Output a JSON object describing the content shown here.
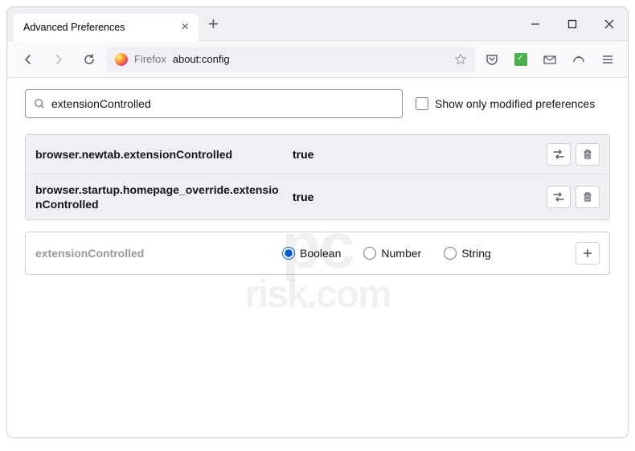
{
  "window": {
    "tab_title": "Advanced Preferences",
    "url_host": "Firefox",
    "url_path": "about:config"
  },
  "search": {
    "value": "extensionControlled",
    "checkbox_label": "Show only modified preferences"
  },
  "prefs": [
    {
      "name": "browser.newtab.extensionControlled",
      "value": "true"
    },
    {
      "name": "browser.startup.homepage_override.extensionControlled",
      "value": "true"
    }
  ],
  "new_pref": {
    "name": "extensionControlled",
    "types": [
      "Boolean",
      "Number",
      "String"
    ],
    "selected": "Boolean"
  },
  "watermark": {
    "line1": "pc",
    "line2": "risk.com"
  }
}
